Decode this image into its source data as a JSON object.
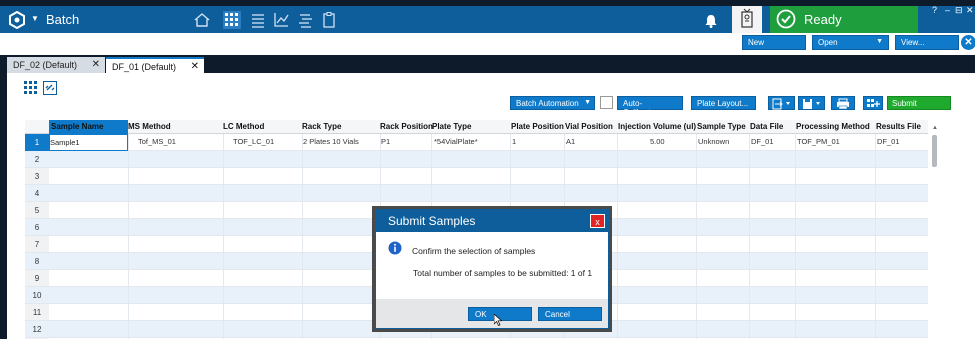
{
  "app": {
    "title": "Batch",
    "colors": {
      "header": "#0f5e9c",
      "accent": "#0f7ac9",
      "ready": "#1f9e3e",
      "submit": "#1faa2e",
      "close": "#e02424"
    }
  },
  "topbar": {
    "icons": [
      "home-icon",
      "grid-icon",
      "list-icon",
      "chart-icon",
      "layers-icon",
      "clipboard-icon"
    ],
    "status": "Ready",
    "window_controls": [
      "?",
      "–",
      "⊟",
      "✕"
    ]
  },
  "actions": {
    "new": "New",
    "open": "Open",
    "view": "View..."
  },
  "tabs": [
    {
      "label": "DF_02 (Default)",
      "close": "✕"
    },
    {
      "label": "DF_01 (Default)",
      "close": "✕"
    }
  ],
  "grid_toolbar": {
    "batch_automation": "Batch Automation",
    "auto_calibrate": "Auto-Calibrate...",
    "plate_layout": "Plate Layout...",
    "submit": "Submit"
  },
  "table": {
    "columns": [
      "Sample Name",
      "MS Method",
      "LC Method",
      "Rack Type",
      "Rack Position",
      "Plate Type",
      "Plate Position",
      "Vial Position",
      "Injection Volume (ul)",
      "Sample Type",
      "Data File",
      "Processing Method",
      "Results File"
    ],
    "row_numbers": [
      "1",
      "2",
      "3",
      "4",
      "5",
      "6",
      "7",
      "8",
      "9",
      "10",
      "11",
      "12"
    ],
    "rows": [
      [
        "Sample1",
        "Tof_MS_01",
        "TOF_LC_01",
        "2 Plates 10 Vials",
        "P1",
        "*54VialPlate*",
        "1",
        "A1",
        "5.00",
        "Unknown",
        "DF_01",
        "TOF_PM_01",
        "DF_01"
      ]
    ]
  },
  "dialog": {
    "title": "Submit Samples",
    "close": "x",
    "message": "Confirm the selection of samples",
    "detail": "Total number of samples to be submitted: 1 of 1",
    "ok": "OK",
    "cancel": "Cancel"
  }
}
